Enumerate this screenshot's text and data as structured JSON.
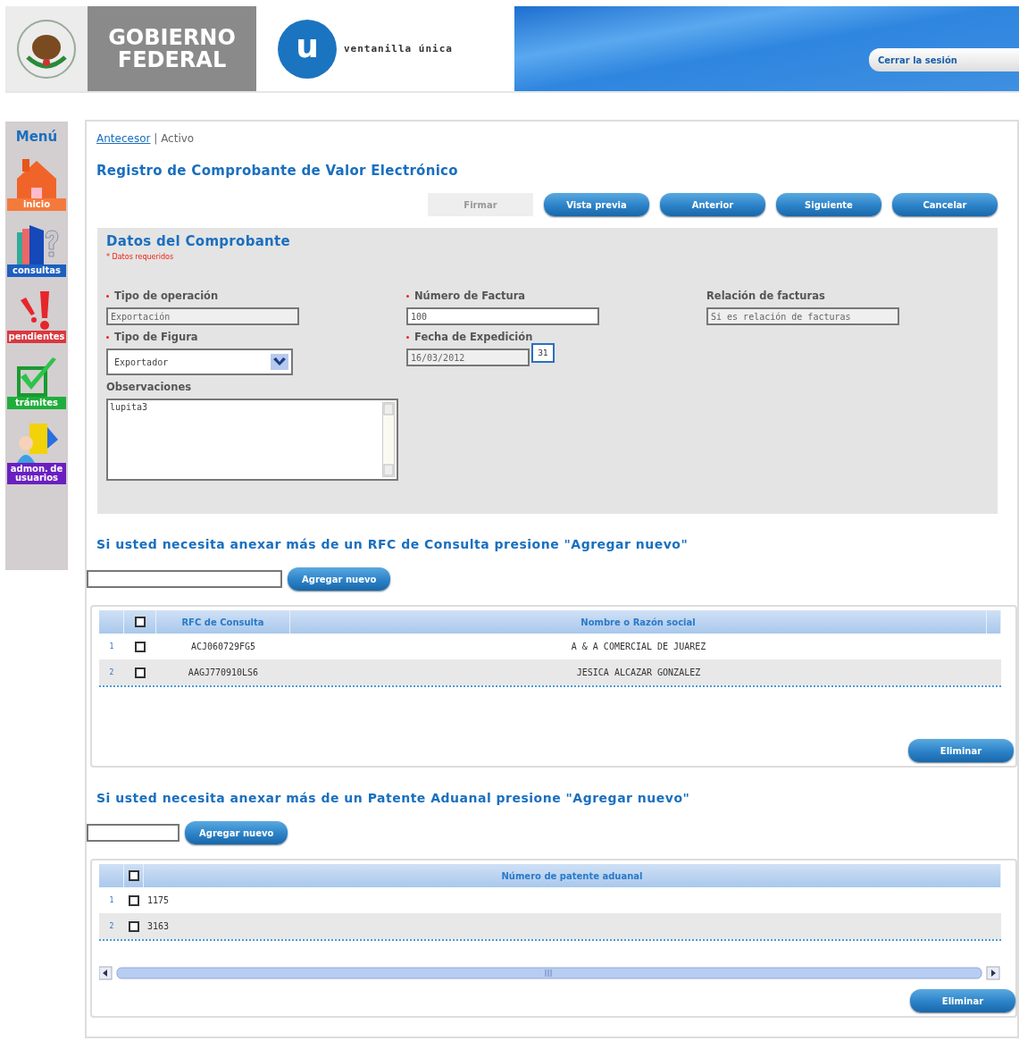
{
  "header": {
    "government_lines": [
      "GOBIERNO",
      "FEDERAL"
    ],
    "logo_letter": "u",
    "brand": "ventanilla única",
    "logout_button": "Cerrar la sesión"
  },
  "menu": {
    "title": "Menú",
    "items": [
      {
        "label": "inicio",
        "kind": "home",
        "color": "#f47a3c"
      },
      {
        "label": "consultas",
        "kind": "help",
        "color": "#1d5fc0"
      },
      {
        "label": "pendientes",
        "kind": "alert",
        "color": "#d9383f"
      },
      {
        "label": "trámites",
        "kind": "check",
        "color": "#1fae3b"
      },
      {
        "label": "admon. de usuarios",
        "kind": "users",
        "color": "#6a1fc0"
      }
    ]
  },
  "breadcrumb": {
    "link": "Antecesor",
    "separator": "|",
    "current": "Activo"
  },
  "page_title": "Registro de Comprobante de Valor Electrónico",
  "actions": [
    {
      "label": "Firmar",
      "disabled": true
    },
    {
      "label": "Vista previa",
      "disabled": false
    },
    {
      "label": "Anterior",
      "disabled": false
    },
    {
      "label": "Siguiente",
      "disabled": false
    },
    {
      "label": "Cancelar",
      "disabled": false
    }
  ],
  "form": {
    "title": "Datos del Comprobante",
    "required_note": "* Datos requeridos",
    "fields": [
      {
        "label": "Tipo de operación",
        "kind": "text",
        "required": true,
        "disabled": true,
        "value": "Exportación"
      },
      {
        "label": "Número de Factura",
        "kind": "text",
        "required": true,
        "disabled": false,
        "value": "100"
      },
      {
        "label": "Relación de facturas",
        "kind": "text",
        "required": false,
        "disabled": true,
        "value": "Si es relación de facturas"
      },
      {
        "label": "Tipo de Figura",
        "kind": "select",
        "required": true,
        "disabled": false,
        "value": "Exportador"
      },
      {
        "label": "Fecha de Expedición",
        "kind": "date",
        "required": true,
        "disabled": true,
        "value": "16/03/2012",
        "calendar_day": "31"
      },
      {
        "label": "Observaciones",
        "kind": "textarea",
        "required": false,
        "disabled": false,
        "value": "lupita3"
      }
    ]
  },
  "sections": [
    {
      "heading": "Si usted necesita anexar más de un RFC de Consulta presione \"Agregar nuevo\"",
      "kind": "rfc",
      "add_button": "Agregar nuevo",
      "header_checked": false,
      "columns": [
        "RFC de Consulta",
        "Nombre o Razón social"
      ],
      "rows": [
        {
          "number": "1",
          "checked": false,
          "cells": [
            "ACJ060729FG5",
            "A & A COMERCIAL DE JUAREZ"
          ]
        },
        {
          "number": "2",
          "checked": false,
          "cells": [
            "AAGJ770910LS6",
            "JESICA ALCAZAR GONZALEZ"
          ]
        }
      ],
      "delete_button": "Eliminar"
    },
    {
      "heading": "Si usted necesita anexar más de un Patente Aduanal presione \"Agregar nuevo\"",
      "kind": "patent",
      "add_button": "Agregar nuevo",
      "header_checked": false,
      "columns": [
        "Número de patente aduanal"
      ],
      "rows": [
        {
          "number": "1",
          "checked": false,
          "cells": [
            "1175"
          ]
        },
        {
          "number": "2",
          "checked": false,
          "cells": [
            "3163"
          ]
        }
      ],
      "delete_button": "Eliminar"
    }
  ]
}
